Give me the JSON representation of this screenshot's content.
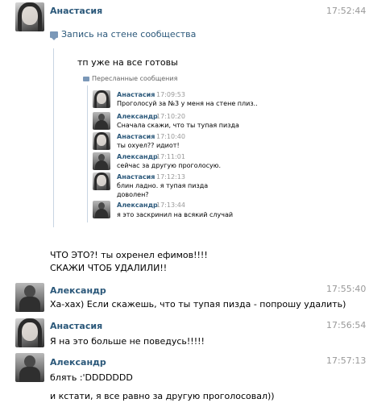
{
  "messages": [
    {
      "name": "Анастасия",
      "time": "17:52:44",
      "avatar": "female"
    },
    {
      "name": "Александр",
      "time": "17:55:40",
      "text": "Ха-хах) Если скажешь, что ты тупая пизда - попрошу удалить)",
      "avatar": "male"
    },
    {
      "name": "Анастасия",
      "time": "17:56:54",
      "text": "Я на это больше не поведусь!!!!!",
      "avatar": "female"
    },
    {
      "name": "Александр",
      "time": "17:57:13",
      "text": "блять :'DDDDDDD",
      "text2": "и кстати, я все равно за другую проголосовал))",
      "avatar": "male"
    }
  ],
  "wall_post": {
    "label": "Запись на стене сообщества",
    "comment": "тп уже на все готовы",
    "forwarded_label": "Пересланные сообщения",
    "forwarded": [
      {
        "name": "Анастасия",
        "time": "17:09:53",
        "lines": [
          "Проголосуй за №3 у меня на стене плиз.."
        ],
        "avatar": "female"
      },
      {
        "name": "Александр",
        "time": "17:10:20",
        "lines": [
          "Сначала скажи, что ты тупая пизда"
        ],
        "avatar": "male"
      },
      {
        "name": "Анастасия",
        "time": "17:10:40",
        "lines": [
          "ты охуел?? идиот!"
        ],
        "avatar": "female"
      },
      {
        "name": "Александр",
        "time": "17:11:01",
        "lines": [
          "сейчас за другую проголосую."
        ],
        "avatar": "male"
      },
      {
        "name": "Анастасия",
        "time": "17:12:13",
        "lines": [
          "блин ладно. я тупая пизда",
          "доволен?"
        ],
        "avatar": "female"
      },
      {
        "name": "Александр",
        "time": "17:13:44",
        "lines": [
          "я это заскринил на всякий случай"
        ],
        "avatar": "male"
      }
    ],
    "reply_lines": [
      "ЧТО ЭТО?! ты охренел ефимов!!!!",
      "СКАЖИ ЧТОБ УДАЛИЛИ!!"
    ]
  },
  "colors": {
    "name": "#2b587a",
    "time": "#999999",
    "quote_line": "#c8d5e2",
    "icon": "#7b98b8"
  }
}
